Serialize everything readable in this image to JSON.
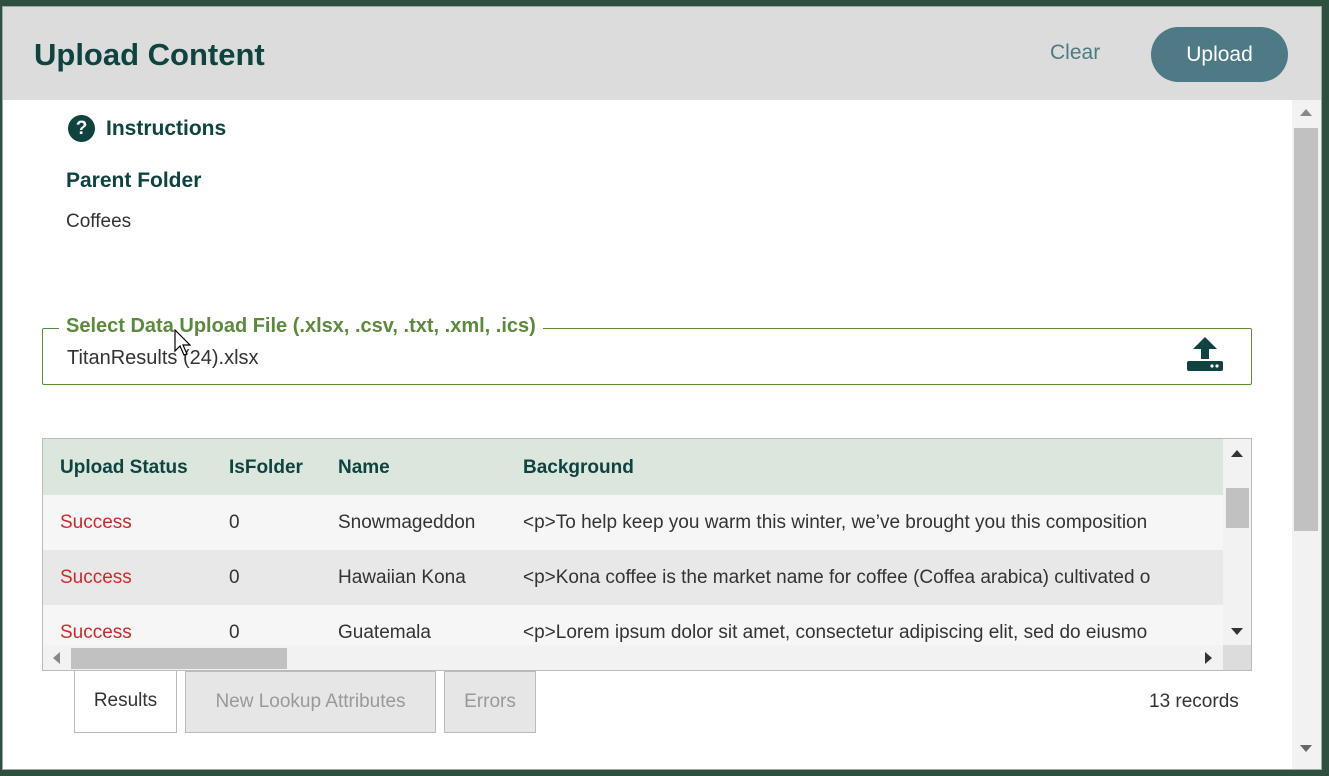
{
  "header": {
    "title": "Upload Content",
    "clear_label": "Clear",
    "upload_label": "Upload"
  },
  "instructions": {
    "icon": "question-circle-icon",
    "label": "Instructions"
  },
  "parent_folder": {
    "label": "Parent Folder",
    "value": "Coffees"
  },
  "file_select": {
    "legend": "Select Data Upload File (.xlsx, .csv, .txt, .xml, .ics)",
    "file_name": "TitanResults (24).xlsx",
    "icon": "upload-icon"
  },
  "grid": {
    "columns": [
      "Upload Status",
      "IsFolder",
      "Name",
      "Background"
    ],
    "rows": [
      {
        "status": "Success",
        "is_folder": "0",
        "name": "Snowmageddon",
        "background": "<p>To help keep you warm this winter, we’ve brought you this composition"
      },
      {
        "status": "Success",
        "is_folder": "0",
        "name": "Hawaiian Kona",
        "background": "<p>Kona coffee is the market name for coffee (Coffea arabica) cultivated o"
      },
      {
        "status": "Success",
        "is_folder": "0",
        "name": "Guatemala",
        "background": "<p>Lorem ipsum dolor sit amet, consectetur adipiscing elit, sed do eiusmo"
      }
    ]
  },
  "tabs": [
    {
      "label": "Results",
      "active": true
    },
    {
      "label": "New Lookup Attributes",
      "active": false
    },
    {
      "label": "Errors",
      "active": false
    }
  ],
  "records_label": "13 records",
  "colors": {
    "primary": "#0f4340",
    "accent_button": "#4e7a85",
    "success_text": "#cc2a2a",
    "file_border": "#5b8a3a",
    "grid_header": "#dbe6dd"
  }
}
